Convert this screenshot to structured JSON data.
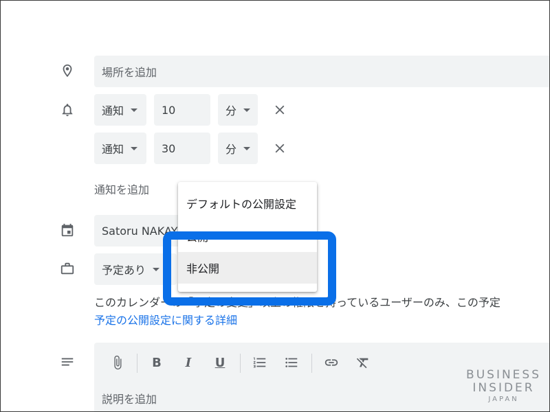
{
  "location": {
    "placeholder": "場所を追加"
  },
  "notifications": [
    {
      "type": "通知",
      "value": "10",
      "unit": "分"
    },
    {
      "type": "通知",
      "value": "30",
      "unit": "分"
    }
  ],
  "add_notification_label": "通知を追加",
  "calendar_owner": "Satoru NAKAY",
  "availability": "予定あり",
  "visibility_menu": {
    "items": [
      "デフォルトの公開設定",
      "公開",
      "非公開"
    ],
    "selected": "非公開"
  },
  "help": {
    "text": "このカレンダーの「予定の変更」以上の権限を持っているユーザーのみ、この予定",
    "link": "予定の公開設定に関する詳細"
  },
  "description": {
    "placeholder": "説明を追加"
  },
  "toolbar": {
    "bold": "B",
    "italic": "I",
    "underline": "U"
  },
  "watermark": {
    "line1": "BUSINESS",
    "line2": "INSIDER",
    "line3": "JAPAN"
  },
  "colors": {
    "highlight": "#0a6fe8",
    "link": "#1a73e8",
    "field_bg": "#f1f3f4"
  }
}
